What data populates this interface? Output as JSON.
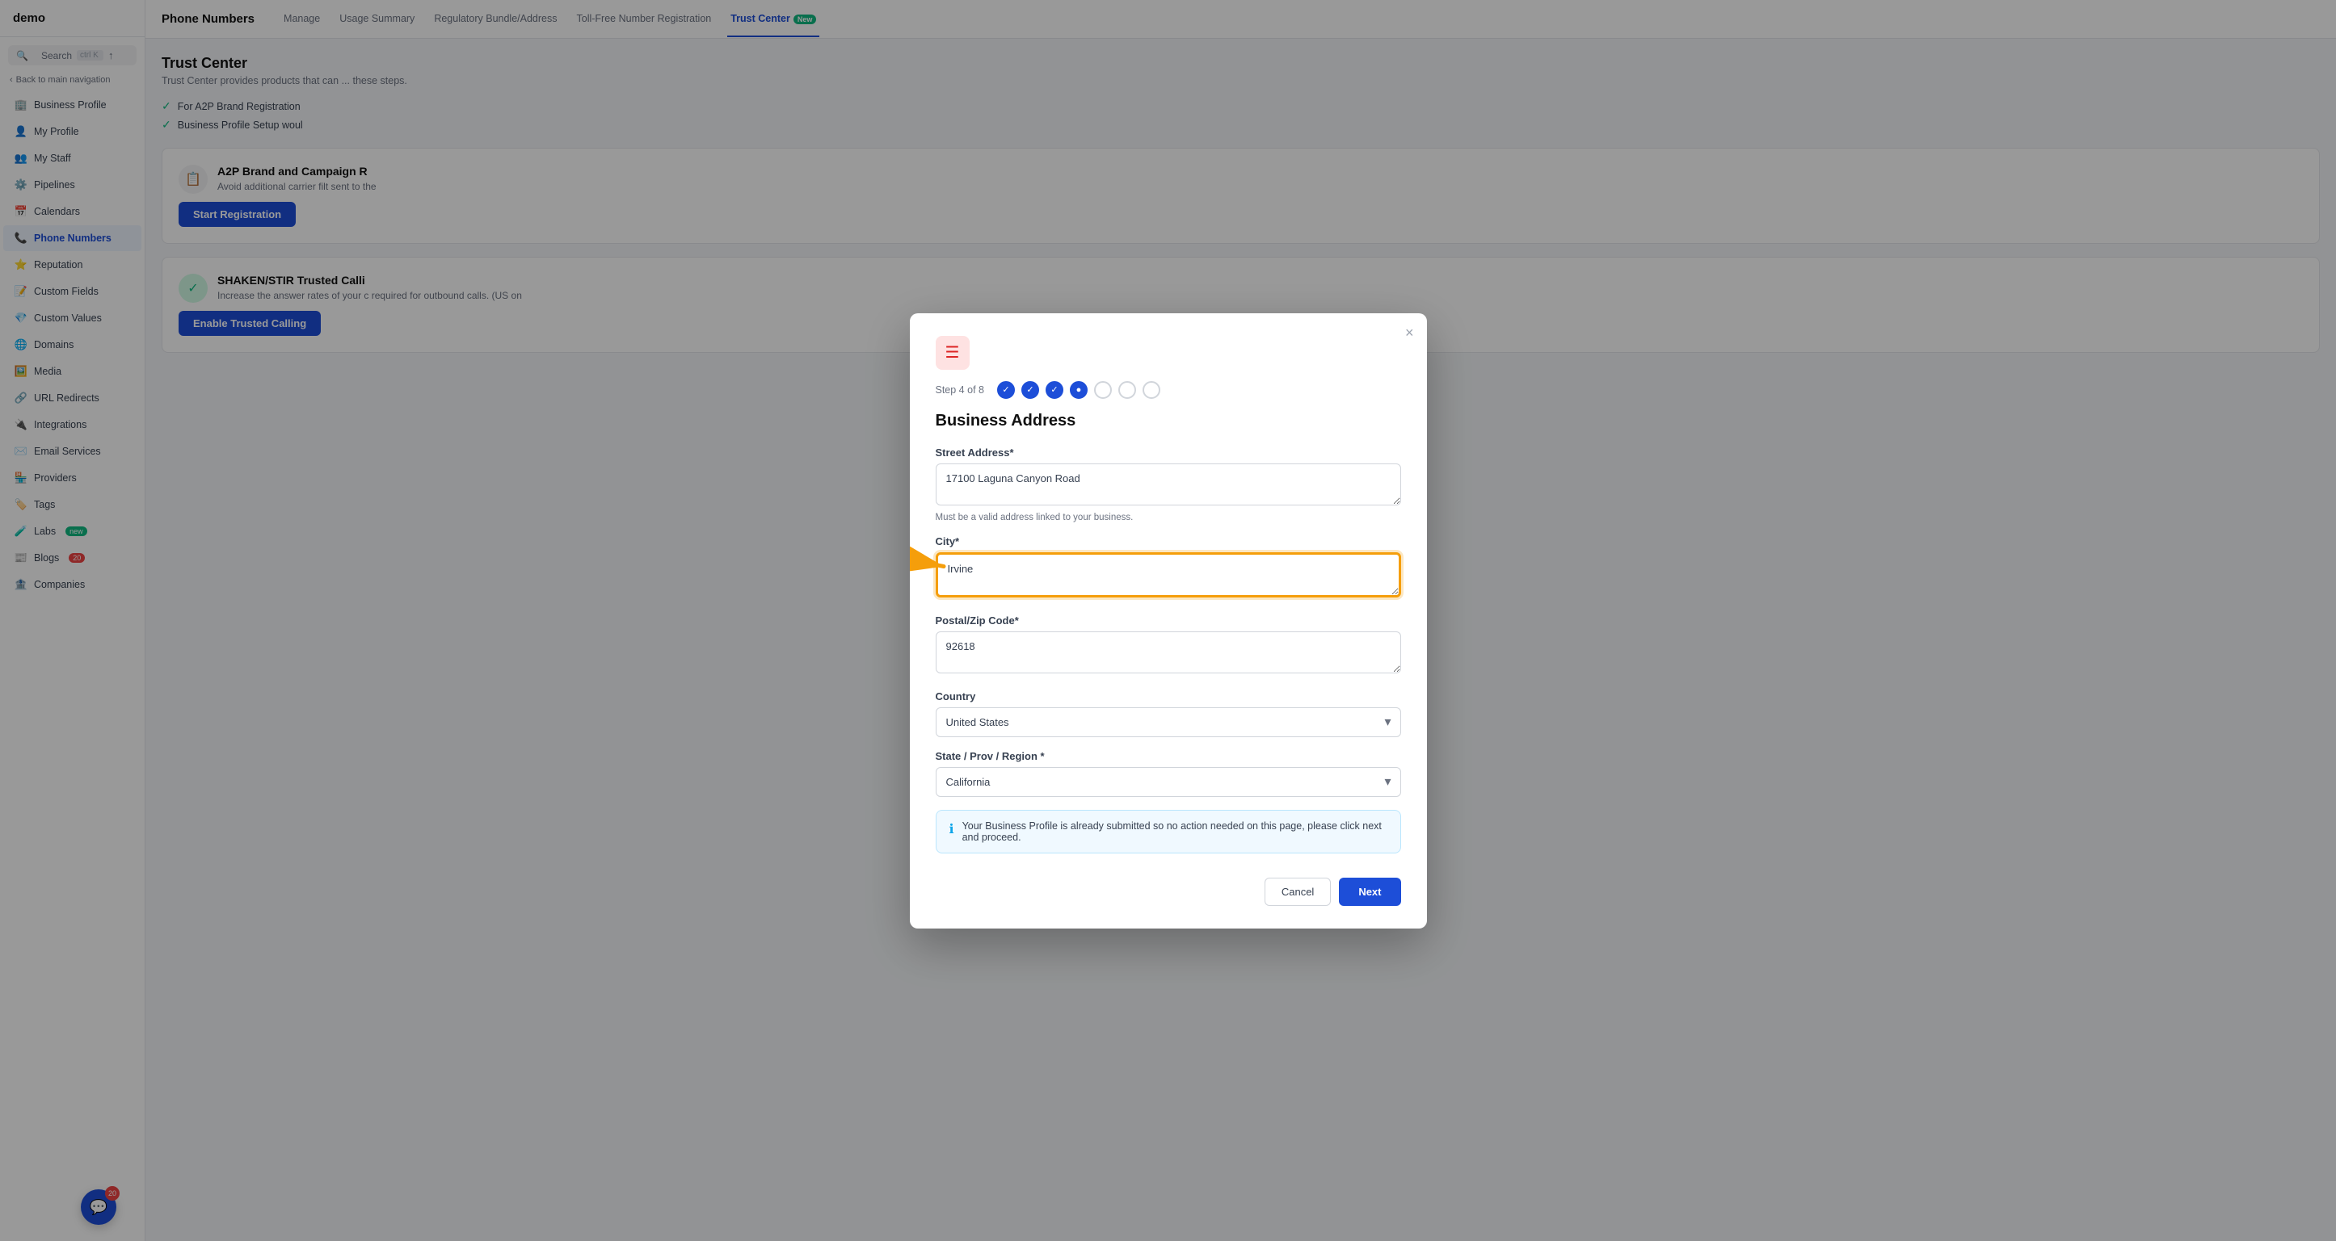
{
  "app": {
    "logo": "demo",
    "search_label": "Search",
    "search_shortcut": "ctrl K"
  },
  "sidebar": {
    "back_label": "Back to main navigation",
    "items": [
      {
        "id": "business-profile",
        "label": "Business Profile",
        "icon": "🏢",
        "active": false
      },
      {
        "id": "my-profile",
        "label": "My Profile",
        "icon": "👤",
        "active": false
      },
      {
        "id": "my-staff",
        "label": "My Staff",
        "icon": "👥",
        "active": false
      },
      {
        "id": "pipelines",
        "label": "Pipelines",
        "icon": "⚙️",
        "active": false
      },
      {
        "id": "calendars",
        "label": "Calendars",
        "icon": "📅",
        "active": false
      },
      {
        "id": "phone-numbers",
        "label": "Phone Numbers",
        "icon": "📞",
        "active": true
      },
      {
        "id": "reputation",
        "label": "Reputation",
        "icon": "⭐",
        "active": false
      },
      {
        "id": "custom-fields",
        "label": "Custom Fields",
        "icon": "📝",
        "active": false
      },
      {
        "id": "custom-values",
        "label": "Custom Values",
        "icon": "💎",
        "active": false
      },
      {
        "id": "domains",
        "label": "Domains",
        "icon": "🌐",
        "active": false
      },
      {
        "id": "media",
        "label": "Media",
        "icon": "🖼️",
        "active": false
      },
      {
        "id": "url-redirects",
        "label": "URL Redirects",
        "icon": "🔗",
        "active": false
      },
      {
        "id": "integrations",
        "label": "Integrations",
        "icon": "🔌",
        "active": false
      },
      {
        "id": "email-services",
        "label": "Email Services",
        "icon": "✉️",
        "active": false
      },
      {
        "id": "providers",
        "label": "Providers",
        "icon": "🏪",
        "active": false
      },
      {
        "id": "tags",
        "label": "Tags",
        "icon": "🏷️",
        "active": false
      },
      {
        "id": "labs",
        "label": "Labs",
        "icon": "🧪",
        "active": false,
        "badge": "new"
      },
      {
        "id": "blogs",
        "label": "Blogs",
        "icon": "📰",
        "active": false,
        "count": 20
      },
      {
        "id": "companies",
        "label": "Companies",
        "icon": "🏦",
        "active": false
      }
    ]
  },
  "topbar": {
    "title": "Phone Numbers",
    "tabs": [
      {
        "id": "manage",
        "label": "Manage",
        "active": false
      },
      {
        "id": "usage-summary",
        "label": "Usage Summary",
        "active": false
      },
      {
        "id": "regulatory",
        "label": "Regulatory Bundle/Address",
        "active": false
      },
      {
        "id": "toll-free",
        "label": "Toll-Free Number Registration",
        "active": false
      },
      {
        "id": "trust-center",
        "label": "Trust Center",
        "active": true,
        "badge": "New"
      }
    ]
  },
  "page": {
    "title": "Trust Center",
    "description": "Trust Center provides products that can",
    "description_suffix": "these steps.",
    "checklist": [
      {
        "text": "For A2P Brand Registration"
      },
      {
        "text": "Business Profile Setup woul"
      }
    ],
    "card1": {
      "title": "A2P Brand and Campaign R",
      "description": "Avoid additional carrier filt sent to the",
      "button_label": "Start Registration"
    },
    "card2": {
      "title": "SHAKEN/STIR Trusted Calli",
      "description": "Increase the answer rates of your c required for outbound calls. (US on",
      "button_label": "Enable Trusted Calling"
    }
  },
  "modal": {
    "header_icon": "☰",
    "close_label": "×",
    "step_label": "Step 4 of 8",
    "steps": [
      {
        "state": "done"
      },
      {
        "state": "done"
      },
      {
        "state": "done"
      },
      {
        "state": "active"
      },
      {
        "state": "empty"
      },
      {
        "state": "empty"
      },
      {
        "state": "empty"
      }
    ],
    "title": "Business Address",
    "fields": {
      "street_label": "Street Address*",
      "street_value": "17100 Laguna Canyon Road",
      "street_hint": "Must be a valid address linked to your business.",
      "city_label": "City*",
      "city_value": "Irvine",
      "postal_label": "Postal/Zip Code*",
      "postal_value": "92618",
      "country_label": "Country",
      "country_value": "United States",
      "state_label": "State / Prov / Region *",
      "state_value": "California"
    },
    "info_message": "Your Business Profile is already submitted so no action needed on this page, please click next and proceed.",
    "cancel_label": "Cancel",
    "next_label": "Next"
  },
  "chat_widget": {
    "count": "20"
  }
}
